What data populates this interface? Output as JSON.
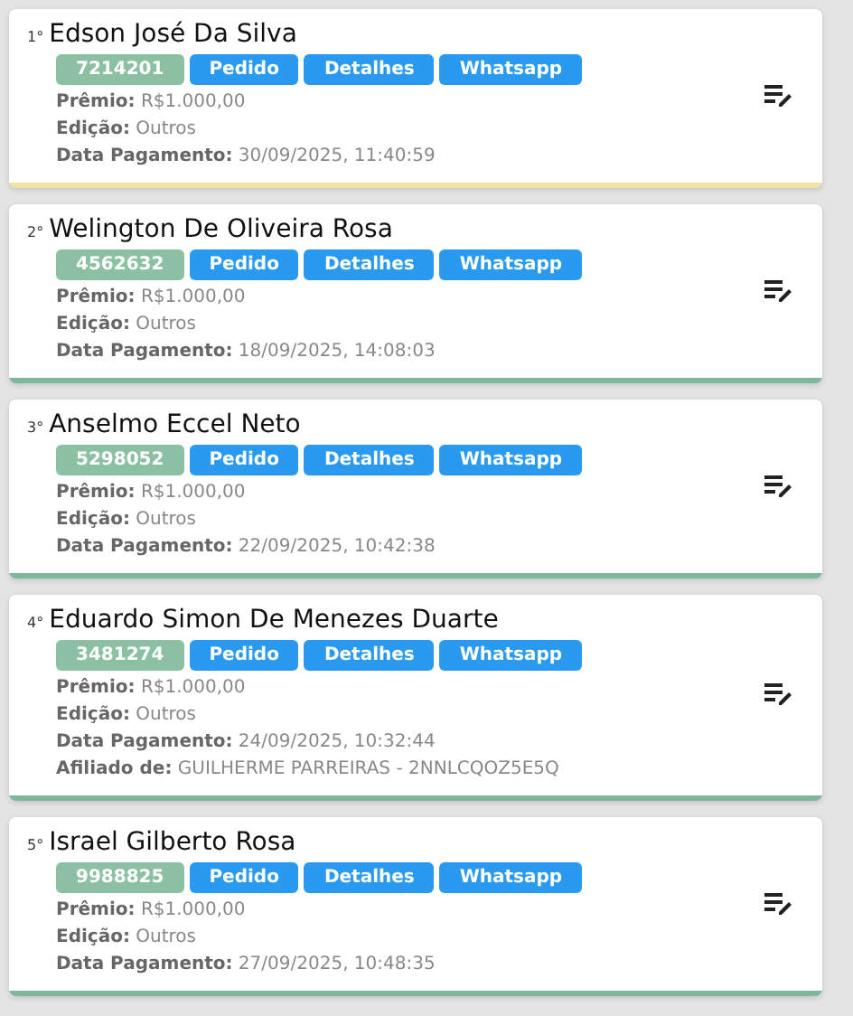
{
  "winners": [
    {
      "rank": "1°",
      "name": "Edson José Da Silva",
      "color": "#f2e2a6",
      "code": "7214201",
      "buttons": [
        "Pedido",
        "Detalhes",
        "Whatsapp"
      ],
      "fields": [
        {
          "label": "Prêmio:",
          "value": "R$1.000,00"
        },
        {
          "label": "Edição:",
          "value": "Outros"
        },
        {
          "label": "Data Pagamento:",
          "value": "30/09/2025, 11:40:59"
        }
      ]
    },
    {
      "rank": "2°",
      "name": "Welington De Oliveira Rosa",
      "color": "#7fb79a",
      "code": "4562632",
      "buttons": [
        "Pedido",
        "Detalhes",
        "Whatsapp"
      ],
      "fields": [
        {
          "label": "Prêmio:",
          "value": "R$1.000,00"
        },
        {
          "label": "Edição:",
          "value": "Outros"
        },
        {
          "label": "Data Pagamento:",
          "value": "18/09/2025, 14:08:03"
        }
      ]
    },
    {
      "rank": "3°",
      "name": "Anselmo Eccel Neto",
      "color": "#7fb79a",
      "code": "5298052",
      "buttons": [
        "Pedido",
        "Detalhes",
        "Whatsapp"
      ],
      "fields": [
        {
          "label": "Prêmio:",
          "value": "R$1.000,00"
        },
        {
          "label": "Edição:",
          "value": "Outros"
        },
        {
          "label": "Data Pagamento:",
          "value": "22/09/2025, 10:42:38"
        }
      ]
    },
    {
      "rank": "4°",
      "name": "Eduardo Simon De Menezes Duarte",
      "color": "#7fb79a",
      "code": "3481274",
      "buttons": [
        "Pedido",
        "Detalhes",
        "Whatsapp"
      ],
      "fields": [
        {
          "label": "Prêmio:",
          "value": "R$1.000,00"
        },
        {
          "label": "Edição:",
          "value": "Outros"
        },
        {
          "label": "Data Pagamento:",
          "value": "24/09/2025, 10:32:44"
        },
        {
          "label": "Afiliado de:",
          "value": "GUILHERME PARREIRAS - 2NNLCQOZ5E5Q"
        }
      ]
    },
    {
      "rank": "5°",
      "name": "Israel Gilberto Rosa",
      "color": "#7fb79a",
      "code": "9988825",
      "buttons": [
        "Pedido",
        "Detalhes",
        "Whatsapp"
      ],
      "fields": [
        {
          "label": "Prêmio:",
          "value": "R$1.000,00"
        },
        {
          "label": "Edição:",
          "value": "Outros"
        },
        {
          "label": "Data Pagamento:",
          "value": "27/09/2025, 10:48:35"
        }
      ]
    }
  ]
}
